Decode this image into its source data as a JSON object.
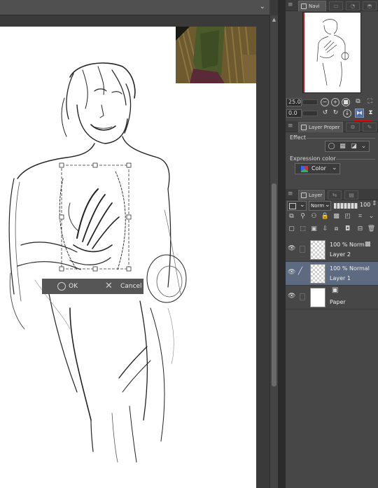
{
  "navigator": {
    "tab_label": "Navi",
    "zoom_value": "25.0",
    "rotate_value": "0.0"
  },
  "layer_property": {
    "tab_label": "Layer Proper",
    "effect_label": "Effect",
    "expression_color_label": "Expression color",
    "expression_color_value": "Color"
  },
  "layer_panel": {
    "tab_label": "Layer",
    "blend_mode": "Norm",
    "opacity": "100",
    "layers": [
      {
        "blend": "100 % Norm",
        "name": "Layer 2",
        "selected": false
      },
      {
        "blend": "100 % Normal",
        "name": "Layer 1",
        "selected": true
      },
      {
        "blend": "",
        "name": "Paper",
        "selected": false
      }
    ]
  },
  "transform_dialog": {
    "ok_label": "OK",
    "cancel_label": "Cancel"
  },
  "colors": {
    "accent": "#4d6fa8",
    "selected_layer": "#5d6a80",
    "red_marker": "#ee0000"
  }
}
